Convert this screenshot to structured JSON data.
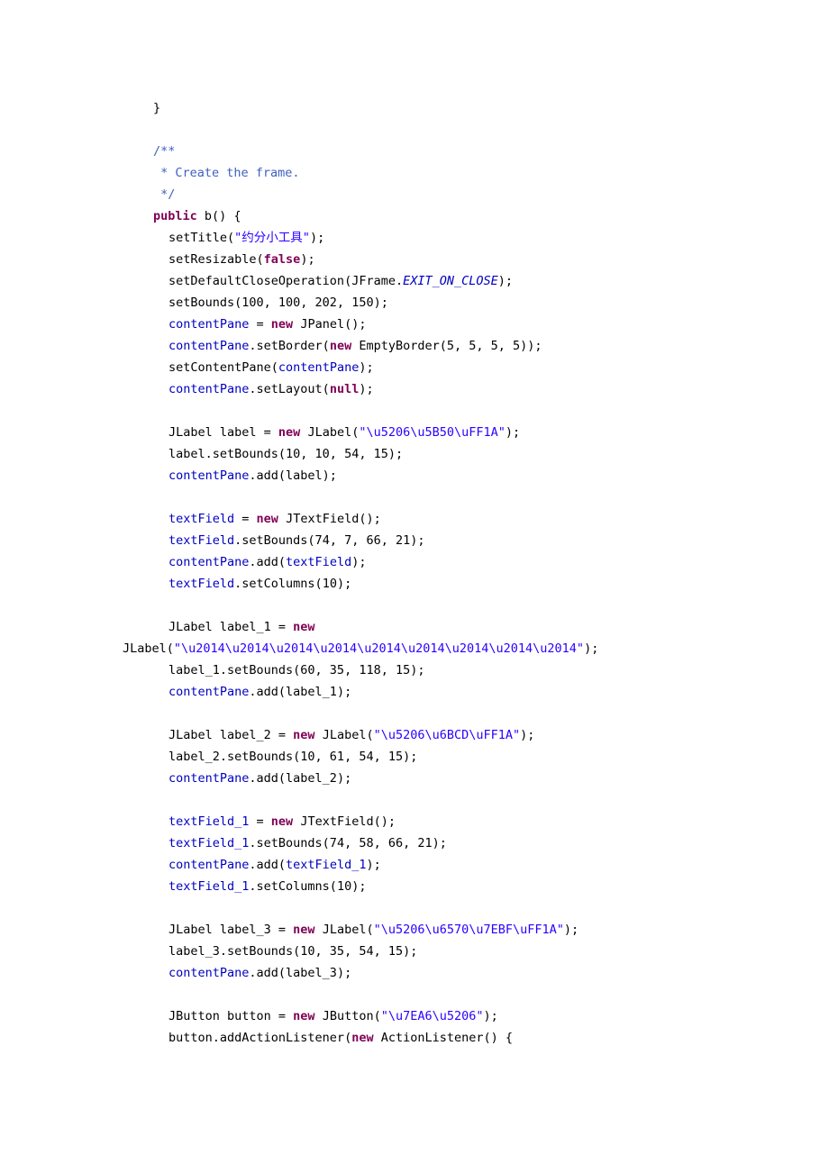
{
  "document": {
    "type": "java-source-code-listing",
    "page_background": "#ffffff",
    "colors": {
      "plain": "#000000",
      "keyword": "#7f0055",
      "comment": "#3f5fbf",
      "string": "#2a00ff",
      "field": "#0000c0",
      "local_variable": "#6a3ef0",
      "static_field": "#0000c0"
    }
  },
  "code": {
    "lines": [
      {
        "indent": 2,
        "tokens": [
          {
            "t": "plain",
            "s": "}"
          }
        ]
      },
      {
        "indent": 0,
        "tokens": []
      },
      {
        "indent": 2,
        "tokens": [
          {
            "t": "comment",
            "s": "/**"
          }
        ]
      },
      {
        "indent": 2,
        "tokens": [
          {
            "t": "comment",
            "s": " * Create the frame."
          }
        ]
      },
      {
        "indent": 2,
        "tokens": [
          {
            "t": "comment",
            "s": " */"
          }
        ]
      },
      {
        "indent": 2,
        "tokens": [
          {
            "t": "keyword",
            "s": "public"
          },
          {
            "t": "plain",
            "s": " b() {"
          }
        ]
      },
      {
        "indent": 3,
        "tokens": [
          {
            "t": "plain",
            "s": "setTitle("
          },
          {
            "t": "string",
            "s": "\""
          },
          {
            "t": "string-cjk",
            "s": "约分小工具"
          },
          {
            "t": "string",
            "s": "\""
          },
          {
            "t": "plain",
            "s": ");"
          }
        ]
      },
      {
        "indent": 3,
        "tokens": [
          {
            "t": "plain",
            "s": "setResizable("
          },
          {
            "t": "keyword",
            "s": "false"
          },
          {
            "t": "plain",
            "s": ");"
          }
        ]
      },
      {
        "indent": 3,
        "tokens": [
          {
            "t": "plain",
            "s": "setDefaultCloseOperation(JFrame."
          },
          {
            "t": "static",
            "s": "EXIT_ON_CLOSE"
          },
          {
            "t": "plain",
            "s": ");"
          }
        ]
      },
      {
        "indent": 3,
        "tokens": [
          {
            "t": "plain",
            "s": "setBounds(100, 100, 202, 150);"
          }
        ]
      },
      {
        "indent": 3,
        "tokens": [
          {
            "t": "field",
            "s": "contentPane"
          },
          {
            "t": "plain",
            "s": " = "
          },
          {
            "t": "keyword",
            "s": "new"
          },
          {
            "t": "plain",
            "s": " JPanel();"
          }
        ]
      },
      {
        "indent": 3,
        "tokens": [
          {
            "t": "field",
            "s": "contentPane"
          },
          {
            "t": "plain",
            "s": ".setBorder("
          },
          {
            "t": "keyword",
            "s": "new"
          },
          {
            "t": "plain",
            "s": " EmptyBorder(5, 5, 5, 5));"
          }
        ]
      },
      {
        "indent": 3,
        "tokens": [
          {
            "t": "plain",
            "s": "setContentPane("
          },
          {
            "t": "field",
            "s": "contentPane"
          },
          {
            "t": "plain",
            "s": ");"
          }
        ]
      },
      {
        "indent": 3,
        "tokens": [
          {
            "t": "field",
            "s": "contentPane"
          },
          {
            "t": "plain",
            "s": ".setLayout("
          },
          {
            "t": "keyword",
            "s": "null"
          },
          {
            "t": "plain",
            "s": ");"
          }
        ]
      },
      {
        "indent": 0,
        "tokens": []
      },
      {
        "indent": 3,
        "tokens": [
          {
            "t": "plain",
            "s": "JLabel label = "
          },
          {
            "t": "keyword",
            "s": "new"
          },
          {
            "t": "plain",
            "s": " JLabel("
          },
          {
            "t": "string",
            "s": "\"\\u5206\\u5B50\\uFF1A\""
          },
          {
            "t": "plain",
            "s": ");"
          }
        ]
      },
      {
        "indent": 3,
        "tokens": [
          {
            "t": "plain",
            "s": "label.setBounds(10, 10, 54, 15);"
          }
        ]
      },
      {
        "indent": 3,
        "tokens": [
          {
            "t": "field",
            "s": "contentPane"
          },
          {
            "t": "plain",
            "s": ".add(label);"
          }
        ]
      },
      {
        "indent": 0,
        "tokens": []
      },
      {
        "indent": 3,
        "tokens": [
          {
            "t": "field",
            "s": "textField"
          },
          {
            "t": "plain",
            "s": " = "
          },
          {
            "t": "keyword",
            "s": "new"
          },
          {
            "t": "plain",
            "s": " JTextField();"
          }
        ]
      },
      {
        "indent": 3,
        "tokens": [
          {
            "t": "field",
            "s": "textField"
          },
          {
            "t": "plain",
            "s": ".setBounds(74, 7, 66, 21);"
          }
        ]
      },
      {
        "indent": 3,
        "tokens": [
          {
            "t": "field",
            "s": "contentPane"
          },
          {
            "t": "plain",
            "s": ".add("
          },
          {
            "t": "field",
            "s": "textField"
          },
          {
            "t": "plain",
            "s": ");"
          }
        ]
      },
      {
        "indent": 3,
        "tokens": [
          {
            "t": "field",
            "s": "textField"
          },
          {
            "t": "plain",
            "s": ".setColumns(10);"
          }
        ]
      },
      {
        "indent": 0,
        "tokens": []
      },
      {
        "indent": 3,
        "tokens": [
          {
            "t": "plain",
            "s": "JLabel label_1 = "
          },
          {
            "t": "keyword",
            "s": "new"
          }
        ]
      },
      {
        "indent": -1,
        "tokens": [
          {
            "t": "plain",
            "s": "JLabel("
          },
          {
            "t": "string",
            "s": "\"\\u2014\\u2014\\u2014\\u2014\\u2014\\u2014\\u2014\\u2014\\u2014\""
          },
          {
            "t": "plain",
            "s": ");"
          }
        ]
      },
      {
        "indent": 3,
        "tokens": [
          {
            "t": "plain",
            "s": "label_1.setBounds(60, 35, 118, 15);"
          }
        ]
      },
      {
        "indent": 3,
        "tokens": [
          {
            "t": "field",
            "s": "contentPane"
          },
          {
            "t": "plain",
            "s": ".add(label_1);"
          }
        ]
      },
      {
        "indent": 0,
        "tokens": []
      },
      {
        "indent": 3,
        "tokens": [
          {
            "t": "plain",
            "s": "JLabel label_2 = "
          },
          {
            "t": "keyword",
            "s": "new"
          },
          {
            "t": "plain",
            "s": " JLabel("
          },
          {
            "t": "string",
            "s": "\"\\u5206\\u6BCD\\uFF1A\""
          },
          {
            "t": "plain",
            "s": ");"
          }
        ]
      },
      {
        "indent": 3,
        "tokens": [
          {
            "t": "plain",
            "s": "label_2.setBounds(10, 61, 54, 15);"
          }
        ]
      },
      {
        "indent": 3,
        "tokens": [
          {
            "t": "field",
            "s": "contentPane"
          },
          {
            "t": "plain",
            "s": ".add(label_2);"
          }
        ]
      },
      {
        "indent": 0,
        "tokens": []
      },
      {
        "indent": 3,
        "tokens": [
          {
            "t": "field",
            "s": "textField_1"
          },
          {
            "t": "plain",
            "s": " = "
          },
          {
            "t": "keyword",
            "s": "new"
          },
          {
            "t": "plain",
            "s": " JTextField();"
          }
        ]
      },
      {
        "indent": 3,
        "tokens": [
          {
            "t": "field",
            "s": "textField_1"
          },
          {
            "t": "plain",
            "s": ".setBounds(74, 58, 66, 21);"
          }
        ]
      },
      {
        "indent": 3,
        "tokens": [
          {
            "t": "field",
            "s": "contentPane"
          },
          {
            "t": "plain",
            "s": ".add("
          },
          {
            "t": "field",
            "s": "textField_1"
          },
          {
            "t": "plain",
            "s": ");"
          }
        ]
      },
      {
        "indent": 3,
        "tokens": [
          {
            "t": "field",
            "s": "textField_1"
          },
          {
            "t": "plain",
            "s": ".setColumns(10);"
          }
        ]
      },
      {
        "indent": 0,
        "tokens": []
      },
      {
        "indent": 3,
        "tokens": [
          {
            "t": "plain",
            "s": "JLabel label_3 = "
          },
          {
            "t": "keyword",
            "s": "new"
          },
          {
            "t": "plain",
            "s": " JLabel("
          },
          {
            "t": "string",
            "s": "\"\\u5206\\u6570\\u7EBF\\uFF1A\""
          },
          {
            "t": "plain",
            "s": ");"
          }
        ]
      },
      {
        "indent": 3,
        "tokens": [
          {
            "t": "plain",
            "s": "label_3.setBounds(10, 35, 54, 15);"
          }
        ]
      },
      {
        "indent": 3,
        "tokens": [
          {
            "t": "field",
            "s": "contentPane"
          },
          {
            "t": "plain",
            "s": ".add(label_3);"
          }
        ]
      },
      {
        "indent": 0,
        "tokens": []
      },
      {
        "indent": 3,
        "tokens": [
          {
            "t": "plain",
            "s": "JButton button = "
          },
          {
            "t": "keyword",
            "s": "new"
          },
          {
            "t": "plain",
            "s": " JButton("
          },
          {
            "t": "string",
            "s": "\"\\u7EA6\\u5206\""
          },
          {
            "t": "plain",
            "s": ");"
          }
        ]
      },
      {
        "indent": 3,
        "tokens": [
          {
            "t": "plain",
            "s": "button.addActionListener("
          },
          {
            "t": "keyword",
            "s": "new"
          },
          {
            "t": "plain",
            "s": " ActionListener() {"
          }
        ]
      }
    ]
  }
}
